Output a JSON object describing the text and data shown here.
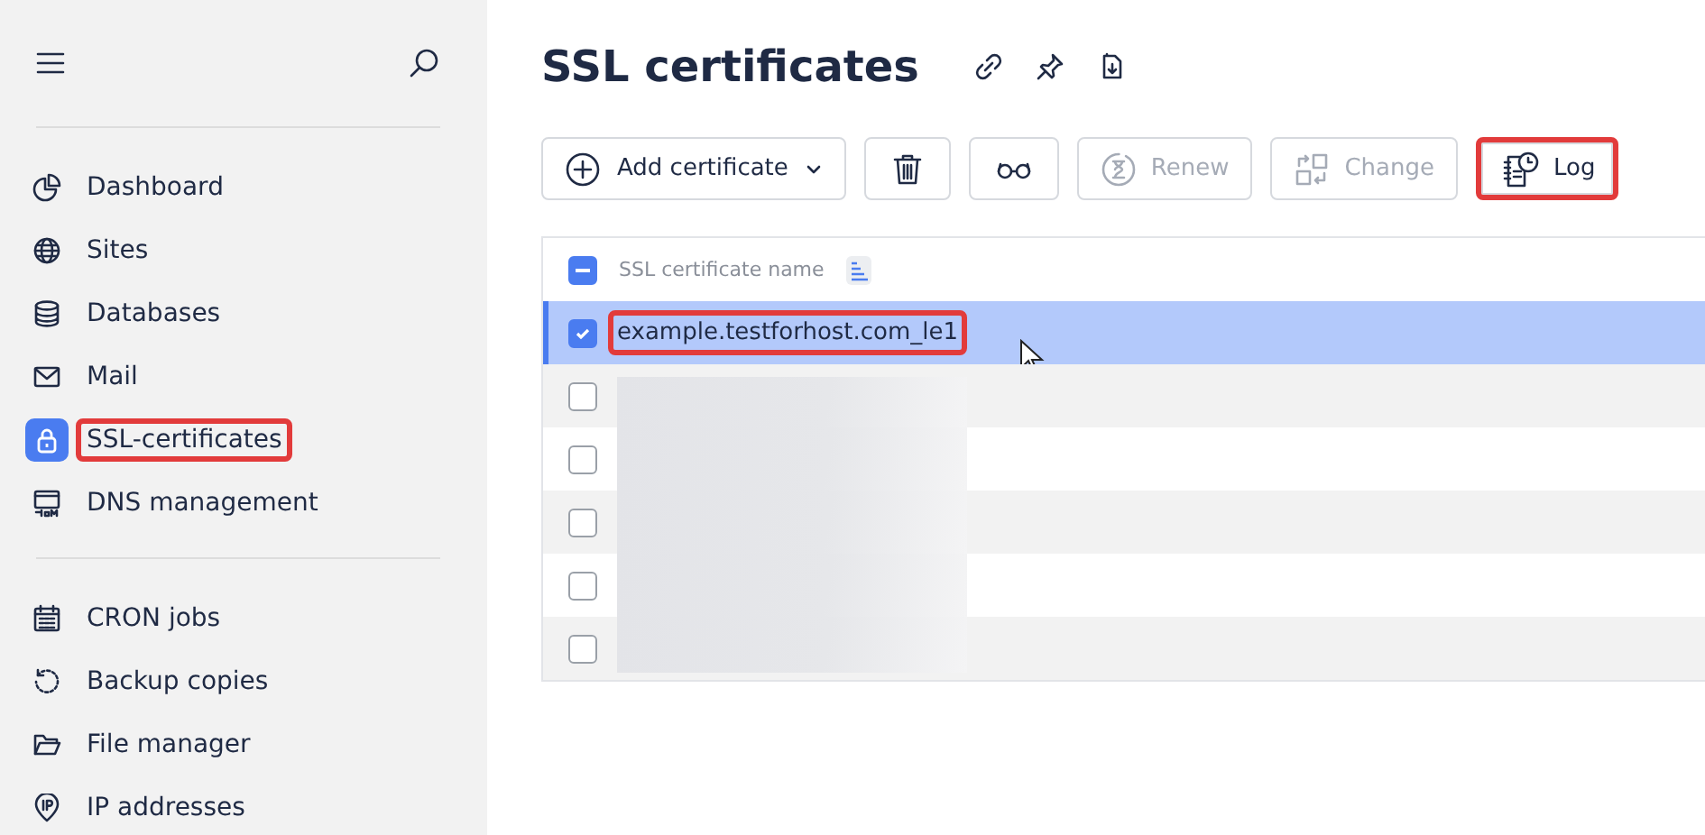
{
  "sidebar": {
    "groups": [
      {
        "items": [
          {
            "label": "Dashboard",
            "selected": false,
            "highlighted": false
          },
          {
            "label": "Sites",
            "selected": false,
            "highlighted": false
          },
          {
            "label": "Databases",
            "selected": false,
            "highlighted": false
          },
          {
            "label": "Mail",
            "selected": false,
            "highlighted": false
          },
          {
            "label": "SSL-certificates",
            "selected": true,
            "highlighted": true
          },
          {
            "label": "DNS management",
            "selected": false,
            "highlighted": false
          }
        ]
      },
      {
        "items": [
          {
            "label": "CRON jobs",
            "selected": false,
            "highlighted": false
          },
          {
            "label": "Backup copies",
            "selected": false,
            "highlighted": false
          },
          {
            "label": "File manager",
            "selected": false,
            "highlighted": false
          },
          {
            "label": "IP addresses",
            "selected": false,
            "highlighted": false
          }
        ]
      }
    ]
  },
  "page": {
    "title": "SSL certificates"
  },
  "toolbar": {
    "buttons": [
      {
        "kind": "dropdown",
        "label": "Add certificate",
        "disabled": false,
        "highlighted": false
      },
      {
        "kind": "icon",
        "disabled": false,
        "highlighted": false
      },
      {
        "kind": "icon",
        "disabled": false,
        "highlighted": false
      },
      {
        "kind": "text",
        "label": "Renew",
        "disabled": true,
        "highlighted": false
      },
      {
        "kind": "text",
        "label": "Change",
        "disabled": true,
        "highlighted": false
      },
      {
        "kind": "text",
        "label": "Log",
        "disabled": false,
        "highlighted": true
      }
    ]
  },
  "table": {
    "columns": [
      {
        "label": "SSL certificate name"
      }
    ],
    "header_indeterminate": true,
    "rows": [
      {
        "name": "example.testforhost.com_le1",
        "checked": true,
        "selected": true,
        "highlighted": true,
        "blurred": false
      },
      {
        "checked": false,
        "selected": false,
        "blurred": true
      },
      {
        "checked": false,
        "selected": false,
        "blurred": true
      },
      {
        "checked": false,
        "selected": false,
        "blurred": true
      },
      {
        "checked": false,
        "selected": false,
        "blurred": true
      },
      {
        "checked": false,
        "selected": false,
        "blurred": true
      }
    ]
  }
}
